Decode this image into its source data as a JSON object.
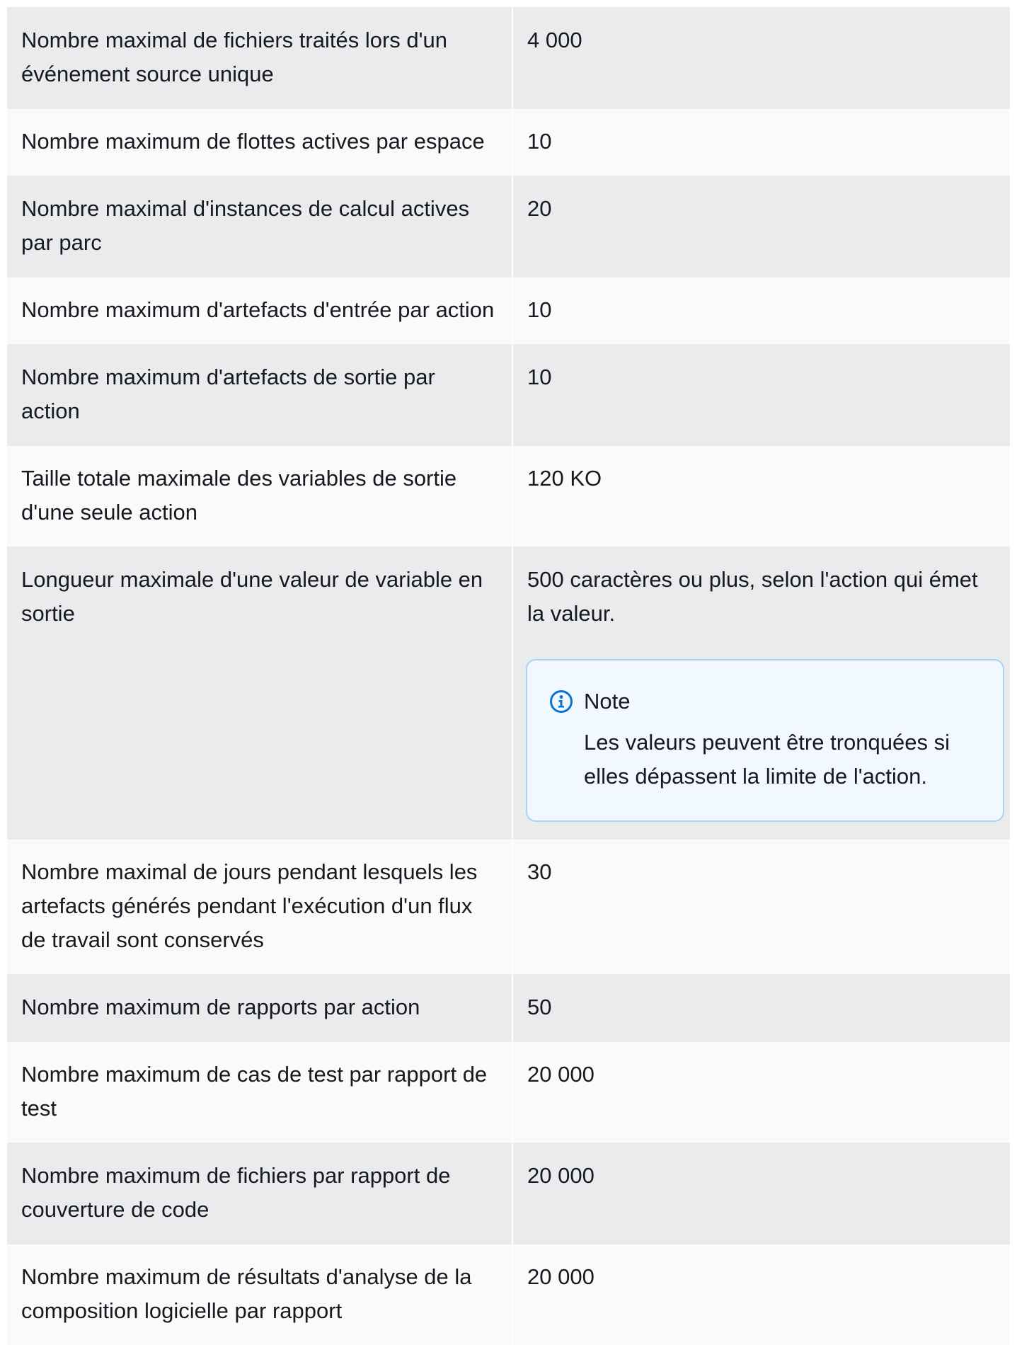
{
  "rows": [
    {
      "name": "Nombre maximal de fichiers traités lors d'un événement source unique",
      "value": "4 000"
    },
    {
      "name": "Nombre maximum de flottes actives par espace",
      "value": "10"
    },
    {
      "name": "Nombre maximal d'instances de calcul actives par parc",
      "value": "20"
    },
    {
      "name": "Nombre maximum d'artefacts d'entrée par action",
      "value": "10"
    },
    {
      "name": "Nombre maximum d'artefacts de sortie par action",
      "value": "10"
    },
    {
      "name": "Taille totale maximale des variables de sortie d'une seule action",
      "value": "120 KO"
    },
    {
      "name": "Longueur maximale d'une valeur de variable en sortie",
      "value": "500 caractères ou plus, selon l'action qui émet la valeur."
    },
    {
      "name": "Nombre maximal de jours pendant lesquels les artefacts générés pendant l'exécution d'un flux de travail sont conservés",
      "value": "30"
    },
    {
      "name": "Nombre maximum de rapports par action",
      "value": "50"
    },
    {
      "name": "Nombre maximum de cas de test par rapport de test",
      "value": "20 000"
    },
    {
      "name": "Nombre maximum de fichiers par rapport de couverture de code",
      "value": "20 000"
    },
    {
      "name": "Nombre maximum de résultats d'analyse de la composition logicielle par rapport",
      "value": "20 000"
    }
  ],
  "note": {
    "icon": "info-icon",
    "title": "Note",
    "text": "Les valeurs peuvent être tronquées si elles dépassent la limite de l'action."
  },
  "colors": {
    "row_shaded": "#e9ebed",
    "row_light": "#fafafa",
    "note_background": "#f1f8ff",
    "note_border": "#a9d4f5",
    "info_icon": "#0972d3"
  }
}
